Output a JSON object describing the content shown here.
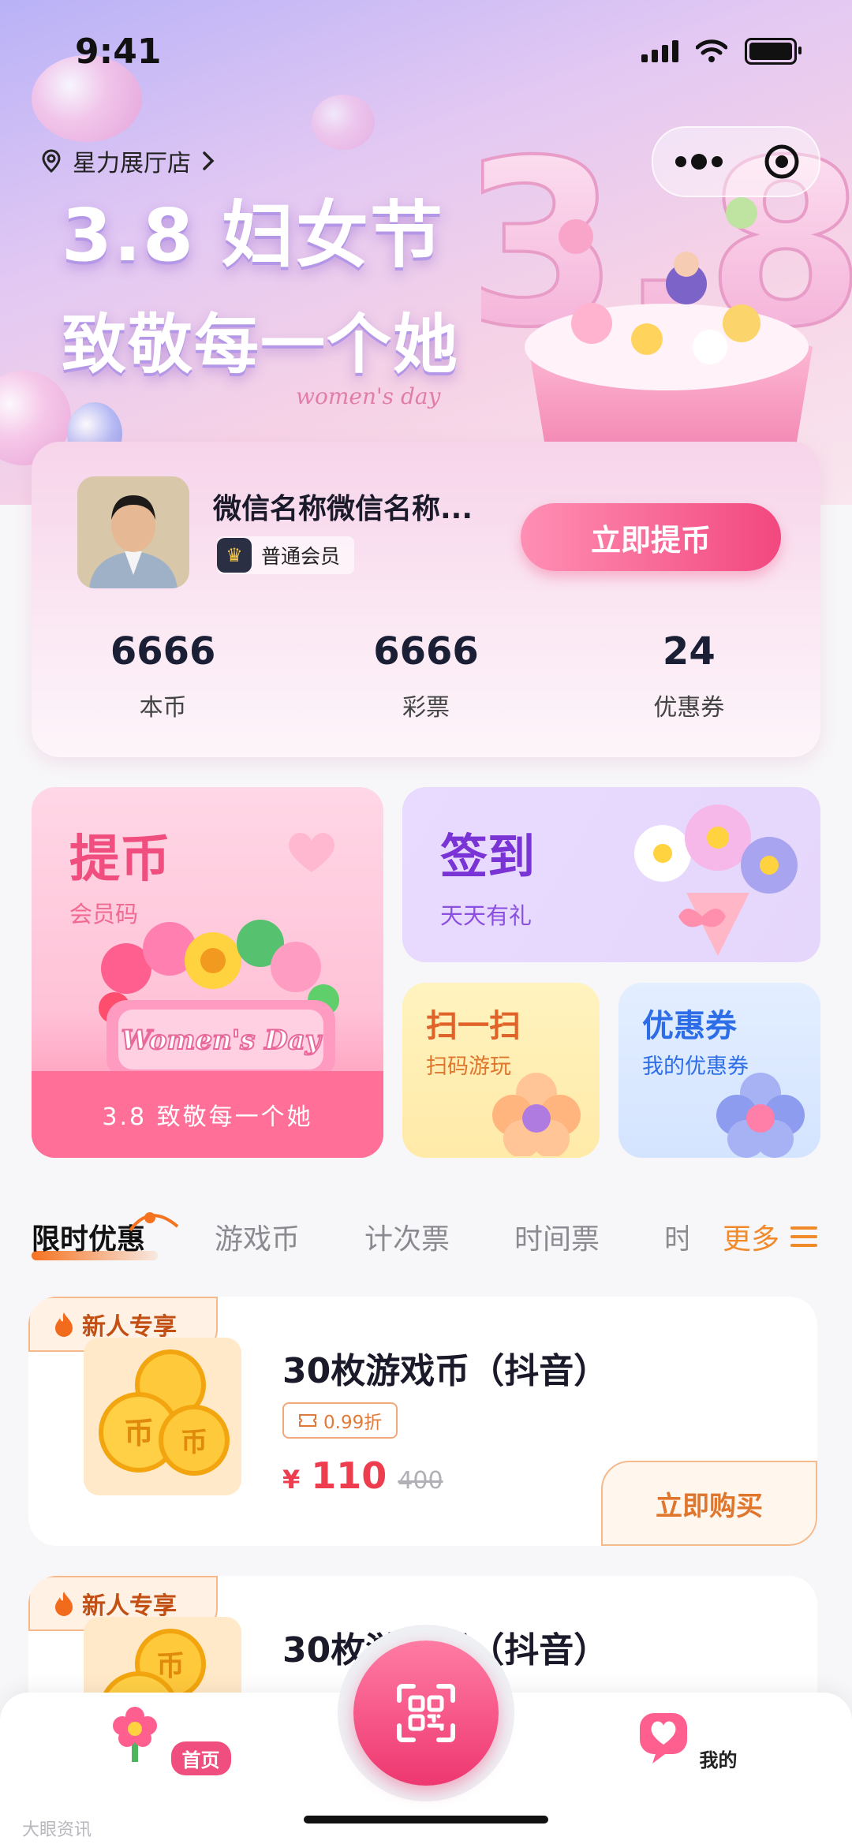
{
  "status": {
    "time": "9:41"
  },
  "hero": {
    "store": "星力展厅店",
    "headline1": "3.8 妇女节",
    "headline2": "致敬每一个她",
    "script": "women's day",
    "art_number": "3.8"
  },
  "profile": {
    "name": "微信名称微信名称...",
    "member_level": "普通会员",
    "withdraw_label": "立即提币",
    "stats": [
      {
        "value": "6666",
        "label": "本币"
      },
      {
        "value": "6666",
        "label": "彩票"
      },
      {
        "value": "24",
        "label": "优惠券"
      }
    ]
  },
  "cards": {
    "withdraw": {
      "title": "提币",
      "subtitle": "会员码",
      "board_text": "Women's Day",
      "ribbon": "3.8 致敬每一个她"
    },
    "checkin": {
      "title": "签到",
      "subtitle": "天天有礼"
    },
    "scan": {
      "title": "扫一扫",
      "subtitle": "扫码游玩"
    },
    "coupon": {
      "title": "优惠券",
      "subtitle": "我的优惠券"
    }
  },
  "tabs": {
    "items": [
      "限时优惠",
      "游戏币",
      "计次票",
      "时间票",
      "时"
    ],
    "more": "更多"
  },
  "products": [
    {
      "tag": "新人专享",
      "coin_char": "币",
      "title": "30枚游戏币（抖音）",
      "discount": "0.99折",
      "currency": "¥",
      "price": "110",
      "original": "400",
      "buy": "立即购买"
    },
    {
      "tag": "新人专享",
      "coin_char": "币",
      "title": "30枚游戏币（抖音）"
    }
  ],
  "tabbar": {
    "home": "首页",
    "me": "我的"
  },
  "watermark": "大眼资讯",
  "colors": {
    "accent_pink": "#f04e7e",
    "accent_orange": "#f08a2a",
    "price_red": "#ee3d4f"
  }
}
